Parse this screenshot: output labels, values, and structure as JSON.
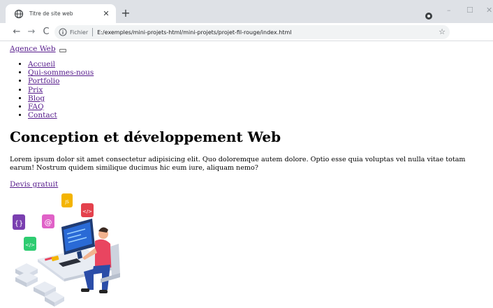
{
  "browser": {
    "tab_title": "Titre de site web",
    "tab_close": "✕",
    "new_tab": "+",
    "security_label": "Fichier",
    "url": "E:/exemples/mini-projets-html/mini-projets/projet-fil-rouge/index.html",
    "star": "☆",
    "back": "←",
    "forward": "→",
    "reload": "C",
    "min": "–",
    "max": "☐",
    "close": "✕"
  },
  "page": {
    "brand": "Agence Web",
    "nav": [
      "Accueil",
      "Qui-sommes-nous",
      "Portfolio",
      "Prix",
      "Blog",
      "FAQ",
      "Contact"
    ],
    "title": "Conception et développement Web",
    "lorem": "Lorem ipsum dolor sit amet consectetur adipisicing elit. Quo doloremque autem dolore. Optio esse quia voluptas vel nulla vitae totam earum! Nostrum quidem similique ducimus hic eum iure, aliquam nemo?",
    "cta": "Devis gratuit"
  },
  "colors": {
    "link": "#551a8b",
    "tabstrip": "#dee1e6"
  }
}
